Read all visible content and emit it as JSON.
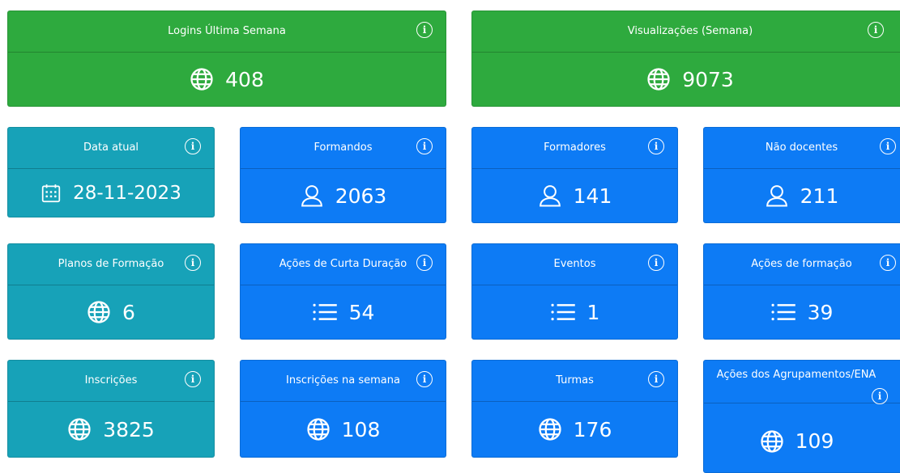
{
  "cards": [
    {
      "title": "Logins Última Semana",
      "value": "408",
      "icon": "globe-icon",
      "color": "#2eaa3e"
    },
    {
      "title": "Visualizações (Semana)",
      "value": "9073",
      "icon": "globe-icon",
      "color": "#2eaa3e"
    },
    {
      "title": "Data atual",
      "value": "28-11-2023",
      "icon": "calendar-icon",
      "color": "#17a2b8"
    },
    {
      "title": "Formandos",
      "value": "2063",
      "icon": "user-icon",
      "color": "#0d7bf5"
    },
    {
      "title": "Formadores",
      "value": "141",
      "icon": "user-icon",
      "color": "#0d7bf5"
    },
    {
      "title": "Não docentes",
      "value": "211",
      "icon": "user-icon",
      "color": "#0d7bf5"
    },
    {
      "title": "Planos de Formação",
      "value": "6",
      "icon": "globe-icon",
      "color": "#17a2b8"
    },
    {
      "title": "Ações de Curta Duração",
      "value": "54",
      "icon": "list-icon",
      "color": "#0d7bf5"
    },
    {
      "title": "Eventos",
      "value": "1",
      "icon": "list-icon",
      "color": "#0d7bf5"
    },
    {
      "title": "Ações de formação",
      "value": "39",
      "icon": "list-icon",
      "color": "#0d7bf5"
    },
    {
      "title": "Inscrições",
      "value": "3825",
      "icon": "globe-icon",
      "color": "#17a2b8"
    },
    {
      "title": "Inscrições na semana",
      "value": "108",
      "icon": "globe-icon",
      "color": "#0d7bf5"
    },
    {
      "title": "Turmas",
      "value": "176",
      "icon": "globe-icon",
      "color": "#0d7bf5"
    },
    {
      "title": "Ações dos Agrupamentos/ENA",
      "value": "109",
      "icon": "globe-icon",
      "color": "#0d7bf5"
    }
  ],
  "info_glyph": "i"
}
